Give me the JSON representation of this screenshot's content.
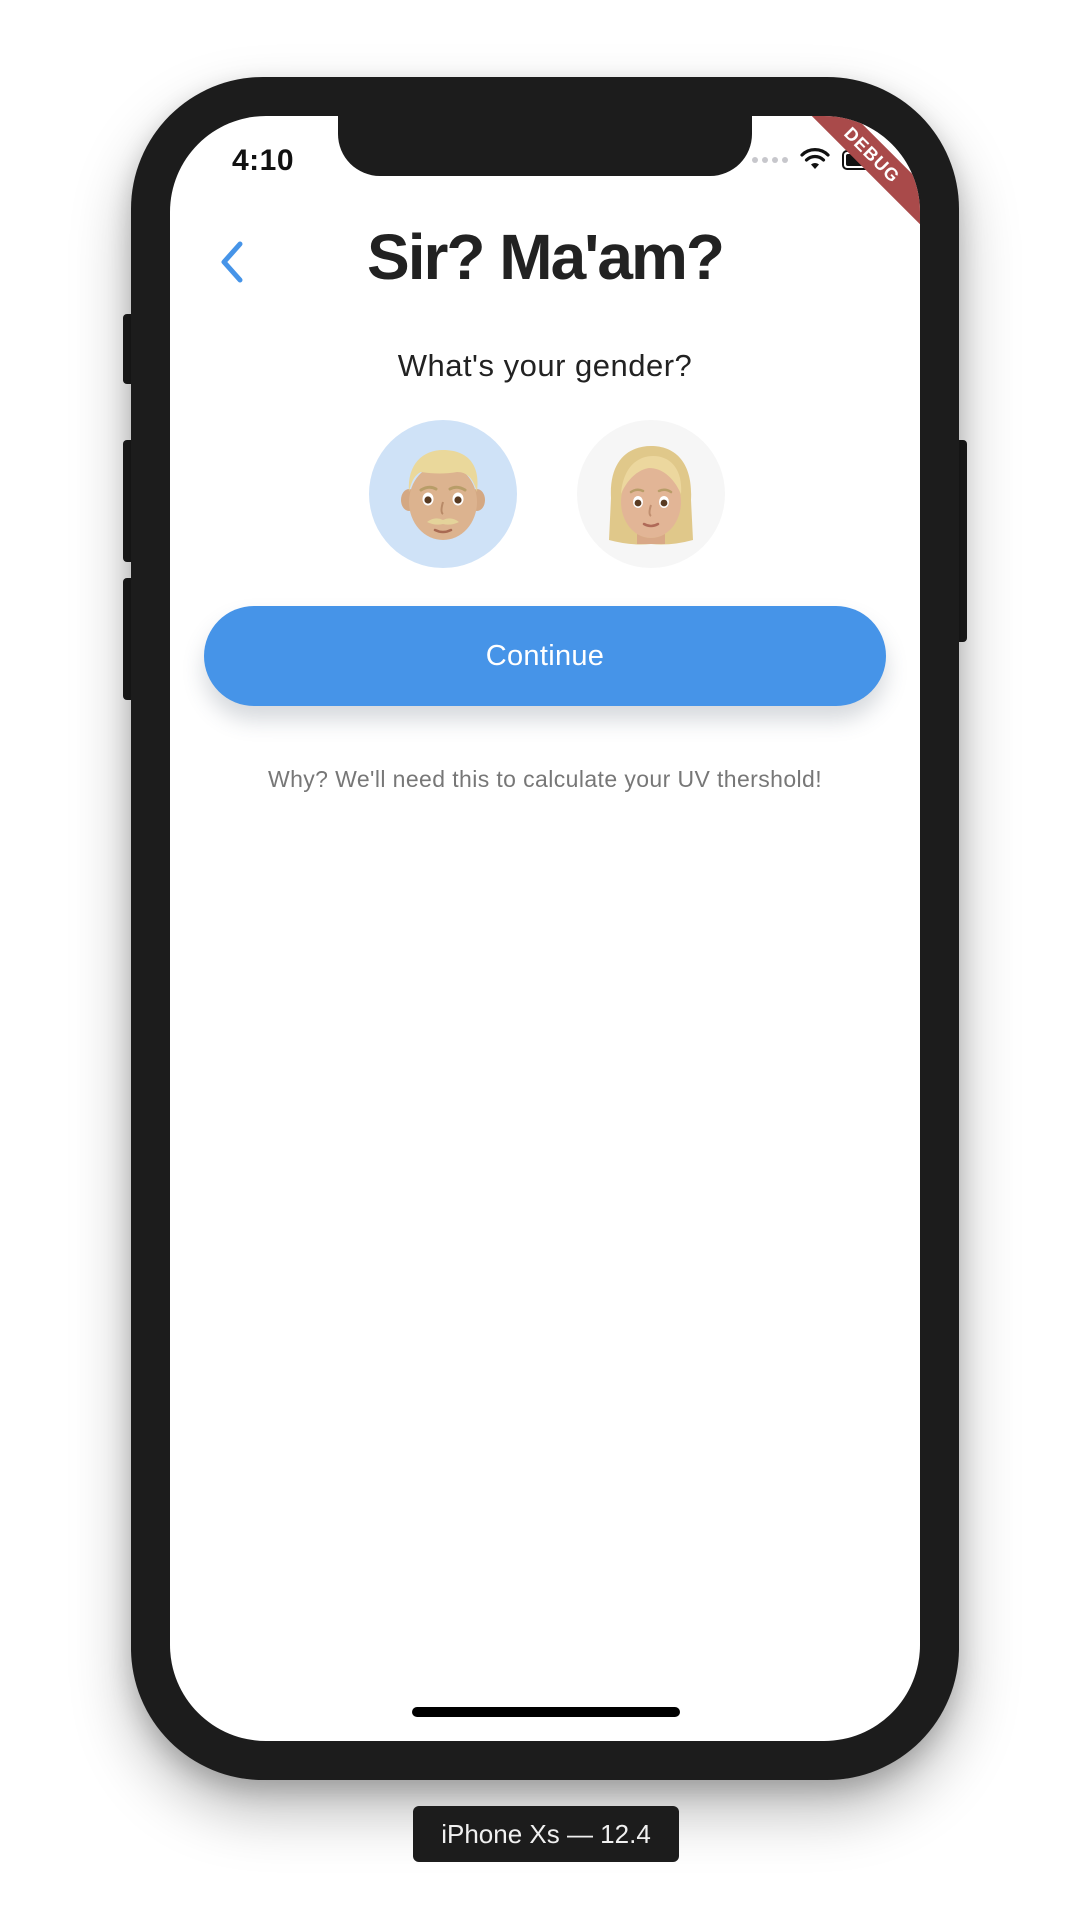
{
  "status_bar": {
    "time": "4:10",
    "icons": [
      "signal-icon",
      "wifi-icon",
      "battery-icon"
    ]
  },
  "debug_banner": "DEBUG",
  "header": {
    "back_icon": "chevron-left-icon",
    "title": "Sir? Ma'am?"
  },
  "question": "What's your gender?",
  "gender_options": [
    {
      "name": "male",
      "emoji": "man-emoji-icon",
      "selected": true
    },
    {
      "name": "female",
      "emoji": "woman-emoji-icon",
      "selected": false
    }
  ],
  "continue_label": "Continue",
  "hint": "Why? We'll need this to calculate your UV thershold!",
  "device_label": "iPhone Xs — 12.4",
  "colors": {
    "accent": "#4694e8",
    "selected_bg": "#cfe2f7",
    "unselected_bg": "#f6f6f6",
    "debug": "#a94a4a"
  }
}
